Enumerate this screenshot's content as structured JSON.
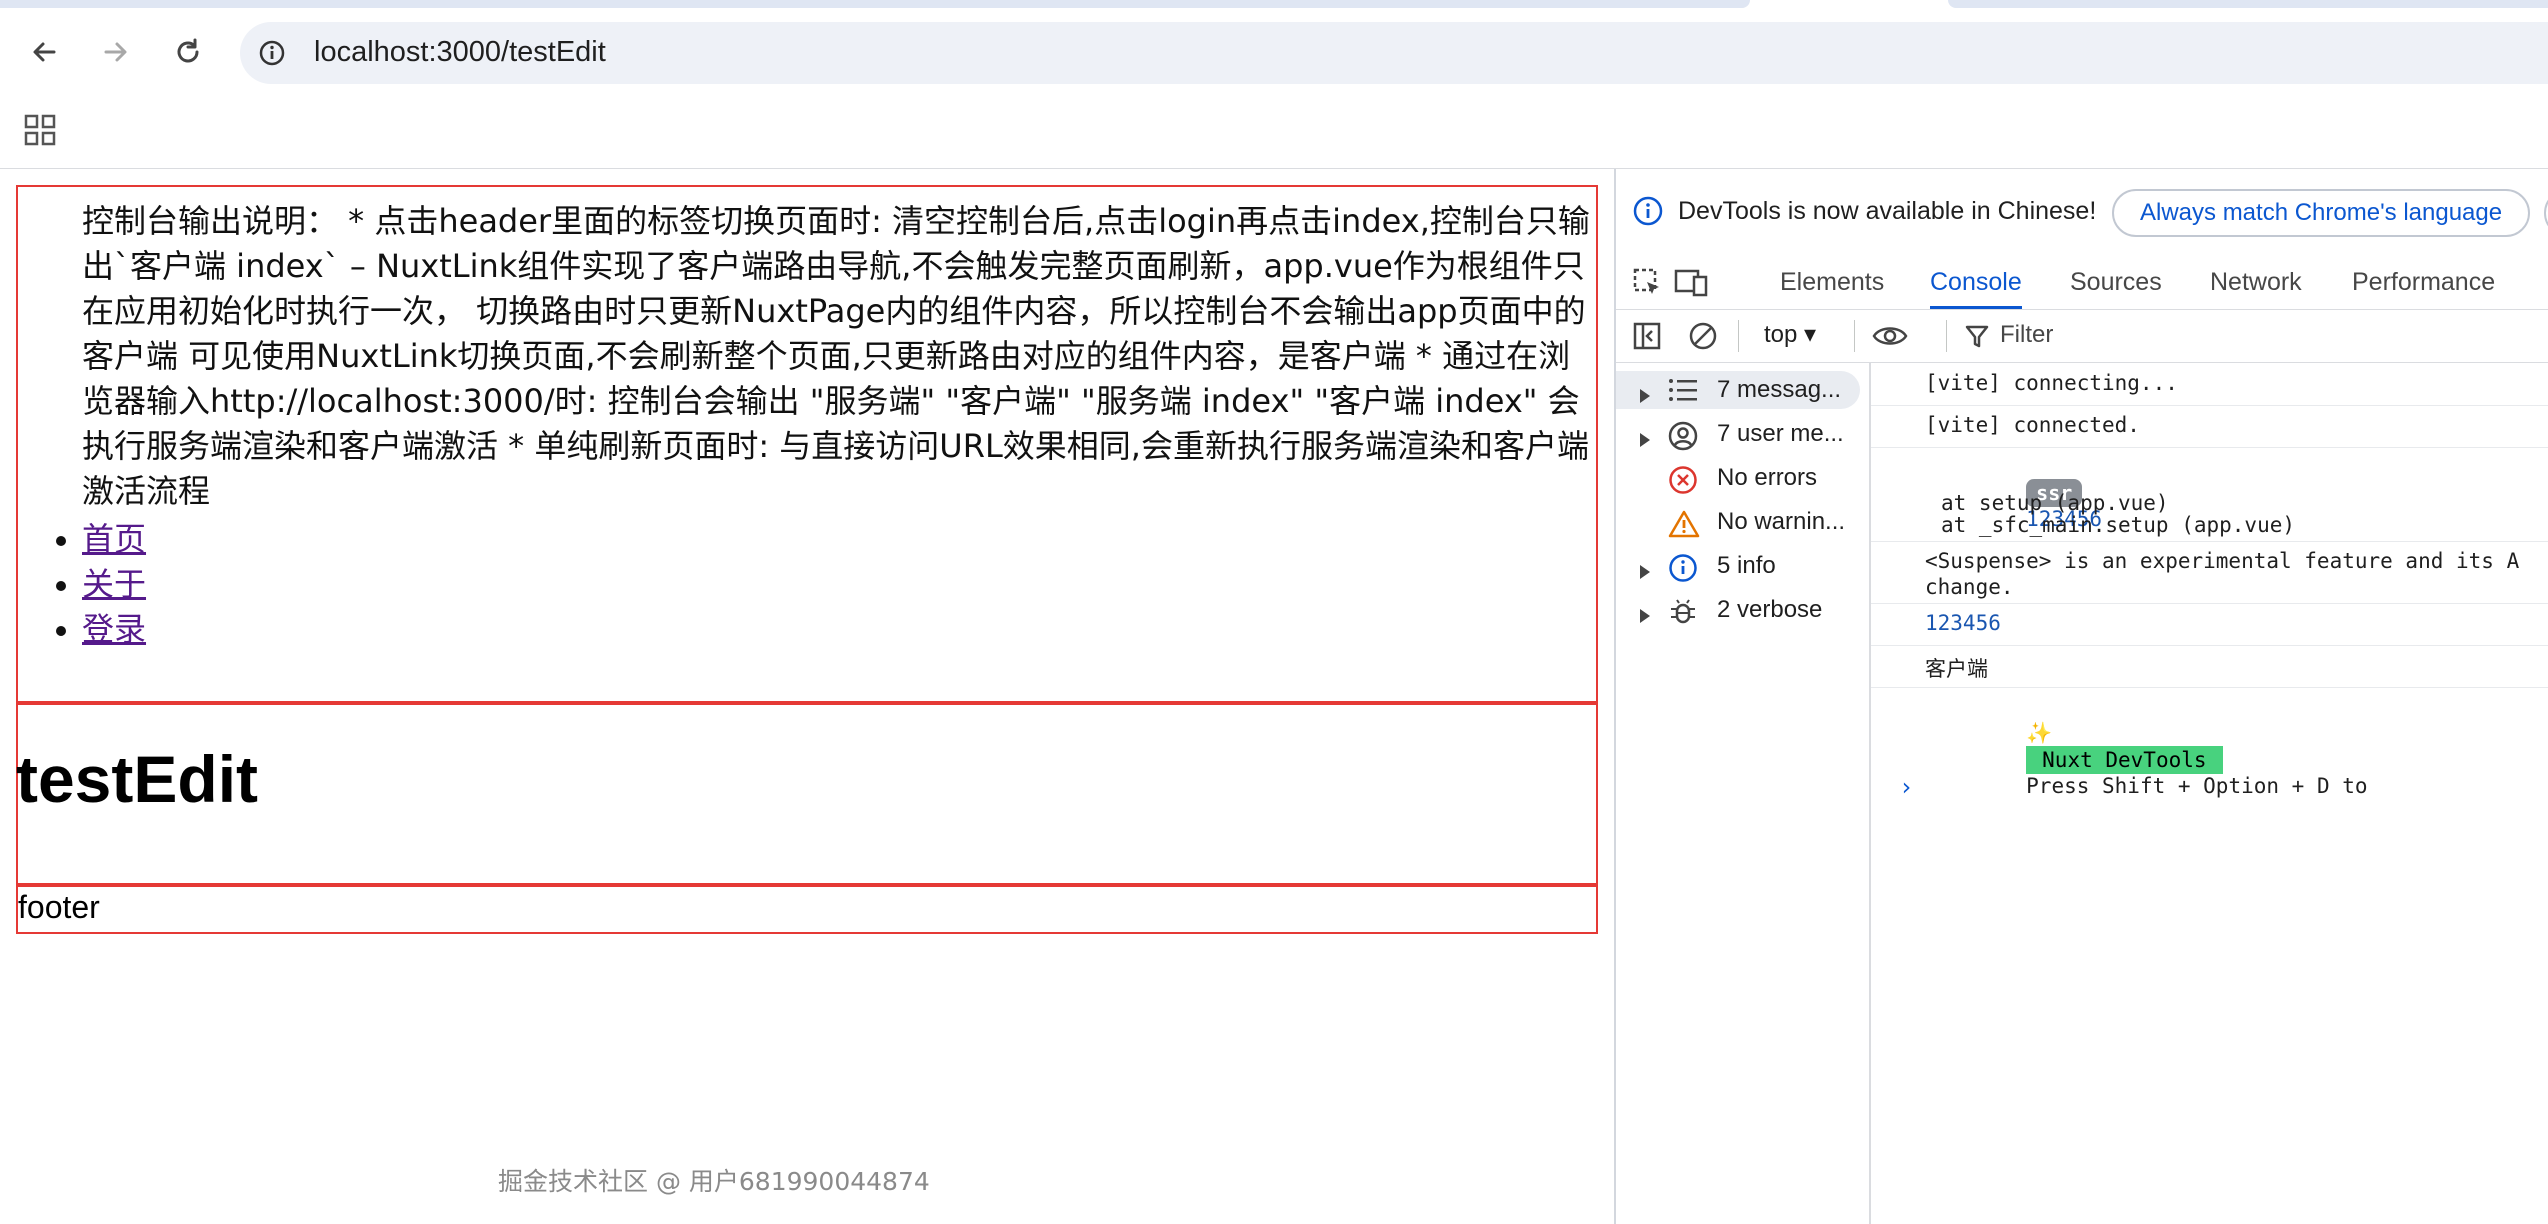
{
  "browser": {
    "url": "localhost:3000/testEdit",
    "icons": {
      "back": "back-arrow-icon",
      "forward": "forward-arrow-icon",
      "reload": "reload-icon",
      "site_info": "site-info-icon",
      "apps": "apps-grid-icon"
    }
  },
  "page": {
    "description": "控制台输出说明： * 点击header里面的标签切换页面时: 清空控制台后,点击login再点击index,控制台只输出`客户端 index` – NuxtLink组件实现了客户端路由导航,不会触发完整页面刷新，app.vue作为根组件只在应用初始化时执行一次， 切换路由时只更新NuxtPage内的组件内容，所以控制台不会输出app页面中的客户端 可见使用NuxtLink切换页面,不会刷新整个页面,只更新路由对应的组件内容，是客户端 * 通过在浏览器输入http://localhost:3000/时: 控制台会输出 \"服务端\" \"客户端\" \"服务端 index\" \"客户端 index\" 会执行服务端渲染和客户端激活 * 单纯刷新页面时: 与直接访问URL效果相同,会重新执行服务端渲染和客户端激活流程",
    "nav_links": [
      "首页",
      "关于",
      "登录"
    ],
    "title": "testEdit",
    "footer": "footer",
    "watermark": "掘金技术社区 @ 用户681990044874"
  },
  "devtools": {
    "banner_text": "DevTools is now available in Chinese!",
    "banner_button": "Always match Chrome's language",
    "tabs": [
      "Elements",
      "Console",
      "Sources",
      "Network",
      "Performance"
    ],
    "active_tab": "Console",
    "context": "top ▾",
    "filter_placeholder": "Filter",
    "sidebar": [
      {
        "label": "7 messag...",
        "icon": "list-icon",
        "expandable": true,
        "selected": true
      },
      {
        "label": "7 user me...",
        "icon": "user-icon",
        "expandable": true,
        "selected": false
      },
      {
        "label": "No errors",
        "icon": "error-icon",
        "expandable": false,
        "selected": false
      },
      {
        "label": "No warnin...",
        "icon": "warning-icon",
        "expandable": false,
        "selected": false
      },
      {
        "label": "5 info",
        "icon": "info-icon",
        "expandable": true,
        "selected": false
      },
      {
        "label": "2 verbose",
        "icon": "bug-icon",
        "expandable": true,
        "selected": false
      }
    ],
    "console": {
      "vite_connecting": "[vite] connecting...",
      "vite_connected": "[vite] connected.",
      "ssr_badge": "ssr",
      "ssr_value": "123456",
      "stack_1": "at setup (app.vue)",
      "stack_2": "at _sfc_main.setup (app.vue)",
      "suspense_1": "<Suspense> is an experimental feature and its A",
      "suspense_2": "change.",
      "value_2": "123456",
      "client": "客户端",
      "sparkle": "✨",
      "nuxt_badge": "Nuxt DevTools",
      "nuxt_msg": "Press Shift + Option + D to",
      "prompt": "›"
    },
    "colors": {
      "accent": "#0b57d0",
      "nuxt_green": "#48d27e",
      "ssr_gray": "#8a8f96",
      "link": "#551a8b",
      "border_red": "#e53935"
    }
  }
}
